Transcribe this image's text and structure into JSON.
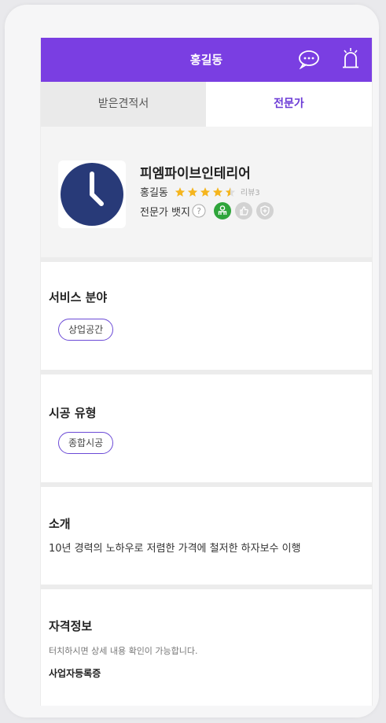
{
  "header": {
    "title": "홍길동",
    "chat_icon": "chat-bubble-icon",
    "alarm_icon": "alarm-bell-icon"
  },
  "tabs": [
    {
      "label": "받은견적서",
      "active": false
    },
    {
      "label": "전문가",
      "active": true
    }
  ],
  "profile": {
    "company": "피엠파이브인테리어",
    "owner": "홍길동",
    "rating": 4.5,
    "review": "리뷰3",
    "badge_label": "전문가 뱃지",
    "badges": [
      "person-badge-icon",
      "thumbs-up-badge-icon",
      "shield-badge-icon"
    ]
  },
  "service": {
    "title": "서비스 분야",
    "tag": "상업공간"
  },
  "construction": {
    "title": "시공 유형",
    "tag": "종합시공"
  },
  "intro": {
    "title": "소개",
    "text": "10년 경력의 노하우로 저렴한 가격에 철저한 하자보수 이행"
  },
  "qualification": {
    "title": "자격정보",
    "hint": "터치하시면 상세 내용 확인이 가능합니다.",
    "item": "사업자등록증"
  },
  "colors": {
    "accent": "#7a3ee2",
    "star": "#f5b51d",
    "badge_active": "#2fa53b",
    "badge_inactive": "#d2d2d2"
  }
}
